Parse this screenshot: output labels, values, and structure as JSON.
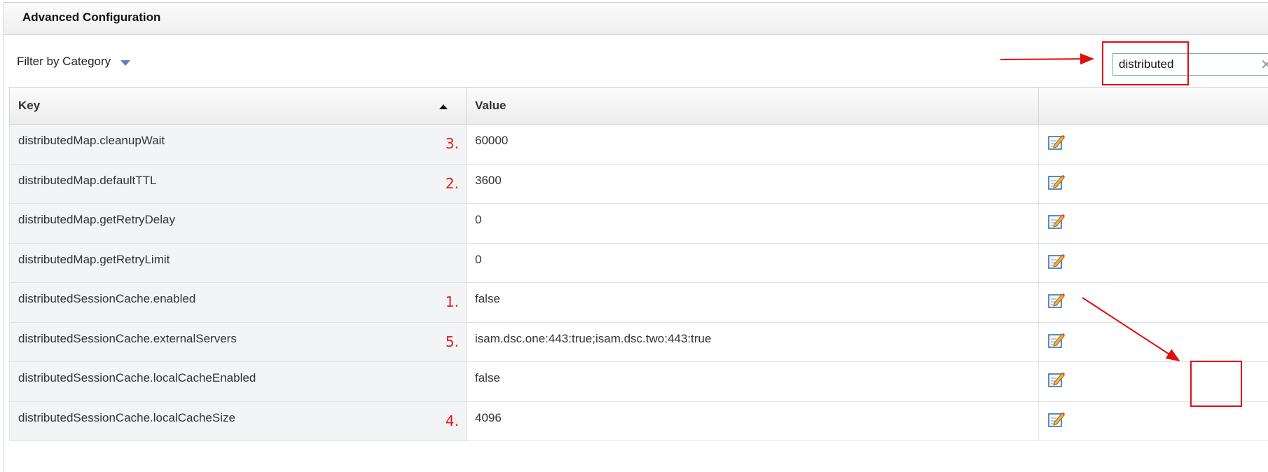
{
  "panel": {
    "title": "Advanced Configuration"
  },
  "filter": {
    "label": "Filter by Category",
    "icon": "caret-down-icon"
  },
  "search": {
    "value": "distributed",
    "clear_icon": "close-icon"
  },
  "table": {
    "columns": {
      "key": "Key",
      "value": "Value",
      "actions": ""
    },
    "sort": {
      "column": "Key",
      "direction": "ascending"
    },
    "rows": [
      {
        "key": "distributedMap.cleanupWait",
        "value": "60000",
        "annotation": "3."
      },
      {
        "key": "distributedMap.defaultTTL",
        "value": "3600",
        "annotation": "2."
      },
      {
        "key": "distributedMap.getRetryDelay",
        "value": "0",
        "annotation": ""
      },
      {
        "key": "distributedMap.getRetryLimit",
        "value": "0",
        "annotation": ""
      },
      {
        "key": "distributedSessionCache.enabled",
        "value": "false",
        "annotation": "1."
      },
      {
        "key": "distributedSessionCache.externalServers",
        "value": "isam.dsc.one:443:true;isam.dsc.two:443:true",
        "annotation": "5."
      },
      {
        "key": "distributedSessionCache.localCacheEnabled",
        "value": "false",
        "annotation": ""
      },
      {
        "key": "distributedSessionCache.localCacheSize",
        "value": "4096",
        "annotation": "4."
      }
    ]
  },
  "colors": {
    "annotation_red": "#e10e0e",
    "caret_blue": "#5a83b5",
    "input_border": "#7aa7c6"
  }
}
